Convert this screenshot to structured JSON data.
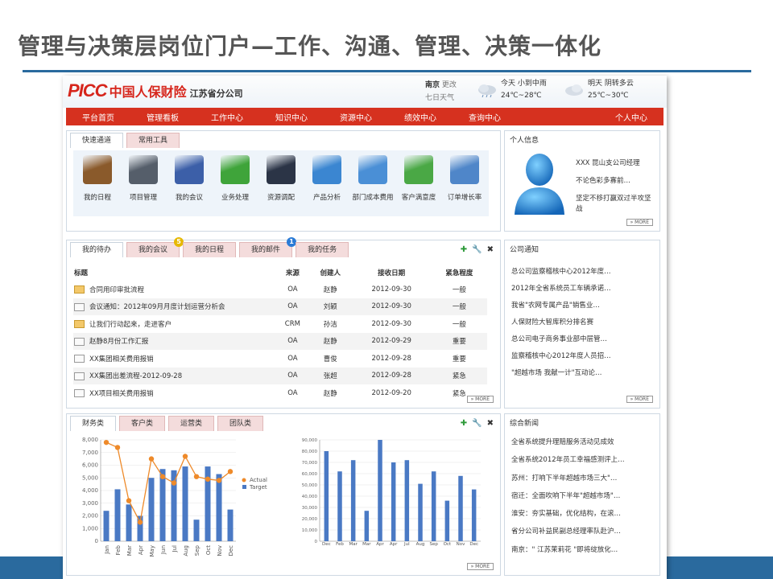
{
  "slide": {
    "title": "管理与决策层岗位门户—工作、沟通、管理、决策一体化"
  },
  "header": {
    "logo_mark": "PICC",
    "logo_cn": "中国人保财险",
    "logo_branch": "江苏省分公司",
    "city": "南京",
    "change": "更改",
    "forecast_label": "七日天气",
    "weather_today": {
      "label": "今天 小到中雨",
      "temp": "24℃~28℃"
    },
    "weather_tomorrow": {
      "label": "明天 阴转多云",
      "temp": "25℃~30℃"
    }
  },
  "nav": [
    "平台首页",
    "管理看板",
    "工作中心",
    "知识中心",
    "资源中心",
    "绩效中心",
    "查询中心",
    "个人中心"
  ],
  "quick": {
    "tabs": [
      "快速通道",
      "常用工具"
    ],
    "items": [
      {
        "label": "我的日程",
        "color": "#8a5a2b"
      },
      {
        "label": "项目管理",
        "color": "#555e6a"
      },
      {
        "label": "我的会议",
        "color": "#3c5fa8"
      },
      {
        "label": "业务处理",
        "color": "#3fa43a"
      },
      {
        "label": "资源调配",
        "color": "#2b3446"
      },
      {
        "label": "产品分析",
        "color": "#3b86d1"
      },
      {
        "label": "部门成本费用",
        "color": "#4a8fd6"
      },
      {
        "label": "客户满意度",
        "color": "#4aa845"
      },
      {
        "label": "订单增长率",
        "color": "#4f86c9"
      }
    ]
  },
  "personal": {
    "title": "个人信息",
    "name": "XXX 昆山支公司经理",
    "motto1": "不论色彩多寡前…",
    "motto2": "坚定不移打赢双过半攻坚战",
    "more": "MORE"
  },
  "tasks": {
    "tabs": [
      {
        "label": "我的待办",
        "badge": ""
      },
      {
        "label": "我的会议",
        "badge": "5"
      },
      {
        "label": "我的日程",
        "badge": ""
      },
      {
        "label": "我的邮件",
        "badge": "1"
      },
      {
        "label": "我的任务",
        "badge": ""
      }
    ],
    "columns": [
      "标题",
      "来源",
      "创建人",
      "接收日期",
      "紧急程度"
    ],
    "rows": [
      {
        "title": "合同用印审批流程",
        "source": "OA",
        "creator": "赵静",
        "date": "2012-09-30",
        "urgency": "一般",
        "opened": true
      },
      {
        "title": "会议通知：2012年09月月度计划运营分析会",
        "source": "OA",
        "creator": "刘颖",
        "date": "2012-09-30",
        "urgency": "一般",
        "opened": false
      },
      {
        "title": "让我们行动起来，走进客户",
        "source": "CRM",
        "creator": "孙洁",
        "date": "2012-09-30",
        "urgency": "一般",
        "opened": true
      },
      {
        "title": "赵静8月份工作汇报",
        "source": "OA",
        "creator": "赵静",
        "date": "2012-09-29",
        "urgency": "重要",
        "opened": false
      },
      {
        "title": "XX集团相关费用报销",
        "source": "OA",
        "creator": "曹俊",
        "date": "2012-09-28",
        "urgency": "重要",
        "opened": false
      },
      {
        "title": "XX集团出差流程-2012-09-28",
        "source": "OA",
        "creator": "张超",
        "date": "2012-09-28",
        "urgency": "紧急",
        "opened": false
      },
      {
        "title": "XX项目相关费用报销",
        "source": "OA",
        "creator": "赵静",
        "date": "2012-09-20",
        "urgency": "紧急",
        "opened": false
      }
    ],
    "more": "MORE"
  },
  "company_notice": {
    "title": "公司通知",
    "items": [
      "总公司监察稽核中心2012年度…",
      "2012年全省系统员工车辆承诺…",
      "我省\"农网专属产品\"销售业…",
      "人保财险大智库积分排名赛",
      "总公司电子商务事业部中层管…",
      "监察稽核中心2012年度人员招…",
      "\"超越市场 我献一计\"互动论…"
    ],
    "more": "MORE"
  },
  "news": {
    "title": "综合新闻",
    "items": [
      "全省系统提升理赔服务活动见成效",
      "全省系统2012年员工幸福感测评上…",
      "苏州：打响下半年超越市场三大\"…",
      "宿迁：全面吹响下半年\"超越市场\"…",
      "淮安：夯实基础，优化结构，在滚…",
      "省分公司补益民副总经理率队赴沪…",
      "南京：\" 江苏茉莉花 \"即将绽放化…"
    ],
    "more": "MORE"
  },
  "charts": {
    "tabs": [
      "财务类",
      "客户类",
      "运营类",
      "团队类"
    ],
    "more": "MORE"
  },
  "chart_data": [
    {
      "type": "bar",
      "categories": [
        "Jan",
        "Feb",
        "Mar",
        "Apr",
        "May",
        "Jun",
        "Jul",
        "Aug",
        "Sep",
        "Oct",
        "Nov",
        "Dec"
      ],
      "series": [
        {
          "name": "Target",
          "type": "bar",
          "values": [
            2400,
            4100,
            2900,
            2000,
            5000,
            5700,
            5600,
            5900,
            1700,
            5900,
            5300,
            2500
          ],
          "color": "#4a79c4"
        },
        {
          "name": "Actual",
          "type": "line",
          "values": [
            7800,
            7400,
            3200,
            1500,
            6500,
            5100,
            4600,
            6700,
            5100,
            4900,
            4800,
            5500
          ],
          "color": "#ee8a2a"
        }
      ],
      "ylim": [
        0,
        8000
      ],
      "yticks": [
        "8,000",
        "7,000",
        "6,000",
        "5,000",
        "4,000",
        "3,000",
        "2,000",
        "1,000",
        "0"
      ],
      "legend": "right"
    },
    {
      "type": "bar",
      "categories": [
        "Dec",
        "Feb",
        "Mar",
        "Mar",
        "Apr",
        "Apr",
        "Jul",
        "Aug",
        "Sep",
        "Oct",
        "Nov",
        "Dec"
      ],
      "series": [
        {
          "name": "",
          "values": [
            80000,
            62000,
            72000,
            27000,
            90000,
            70000,
            72000,
            51000,
            62000,
            36000,
            58000,
            46000
          ],
          "color": "#4a79c4"
        }
      ],
      "ylim": [
        0,
        90000
      ],
      "yticks": [
        "90,000",
        "80,000",
        "70,000",
        "60,000",
        "50,000",
        "40,000",
        "30,000",
        "20,000",
        "10,000",
        "0"
      ]
    }
  ]
}
